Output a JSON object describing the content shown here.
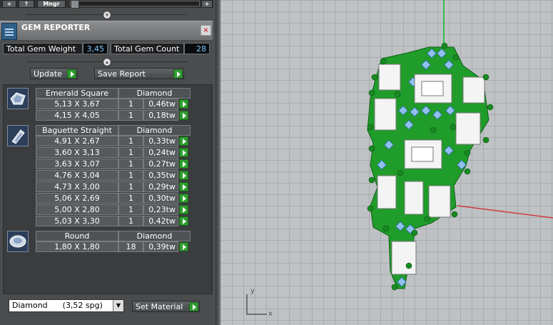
{
  "toolbar": {
    "plus_label": "+",
    "up_label": "↑",
    "mngr_label": "Mngr",
    "add_label": "+"
  },
  "reporter": {
    "title": "GEM REPORTER",
    "close_label": "×"
  },
  "totals": {
    "weight_label": "Total Gem Weight",
    "weight_value": "3,45",
    "count_label": "Total Gem Count",
    "count_value": "28"
  },
  "actions": {
    "update_label": "Update",
    "save_report_label": "Save Report"
  },
  "groups": [
    {
      "icon": "emerald-cut-gem-icon",
      "name": "Emerald Square",
      "material": "Diamond",
      "rows": [
        {
          "size": "5,13 X 3,67",
          "count": "1",
          "weight": "0,46tw"
        },
        {
          "size": "4,15 X 4,05",
          "count": "1",
          "weight": "0,18tw"
        }
      ]
    },
    {
      "icon": "baguette-gem-icon",
      "name": "Baguette Straight",
      "material": "Diamond",
      "rows": [
        {
          "size": "4,91 X 2,67",
          "count": "1",
          "weight": "0,33tw"
        },
        {
          "size": "3,60 X 3,13",
          "count": "1",
          "weight": "0,24tw"
        },
        {
          "size": "3,63 X 3,07",
          "count": "1",
          "weight": "0,27tw"
        },
        {
          "size": "4,76 X 3,04",
          "count": "1",
          "weight": "0,35tw"
        },
        {
          "size": "4,73 X 3,00",
          "count": "1",
          "weight": "0,29tw"
        },
        {
          "size": "5,06 X 2,69",
          "count": "1",
          "weight": "0,30tw"
        },
        {
          "size": "5,00 X 2,80",
          "count": "1",
          "weight": "0,23tw"
        },
        {
          "size": "5,03 X 3,30",
          "count": "1",
          "weight": "0,42tw"
        }
      ]
    },
    {
      "icon": "round-gem-icon",
      "name": "Round",
      "material": "Diamond",
      "rows": [
        {
          "size": "1,80 X 1,80",
          "count": "18",
          "weight": "0,39tw"
        }
      ]
    }
  ],
  "material_select": {
    "value": "Diamond      (3,52 spg)",
    "set_label": "Set Material"
  },
  "viewport": {
    "axis_y": "y",
    "axis_x": "x",
    "colors": {
      "metal": "#1f9c2a",
      "stone_white": "#f4f4f4",
      "stone_blue": "#8fc0f0",
      "grid": "#a9acae",
      "axis_red": "#d23a3a",
      "axis_green": "#2fc24a"
    }
  }
}
